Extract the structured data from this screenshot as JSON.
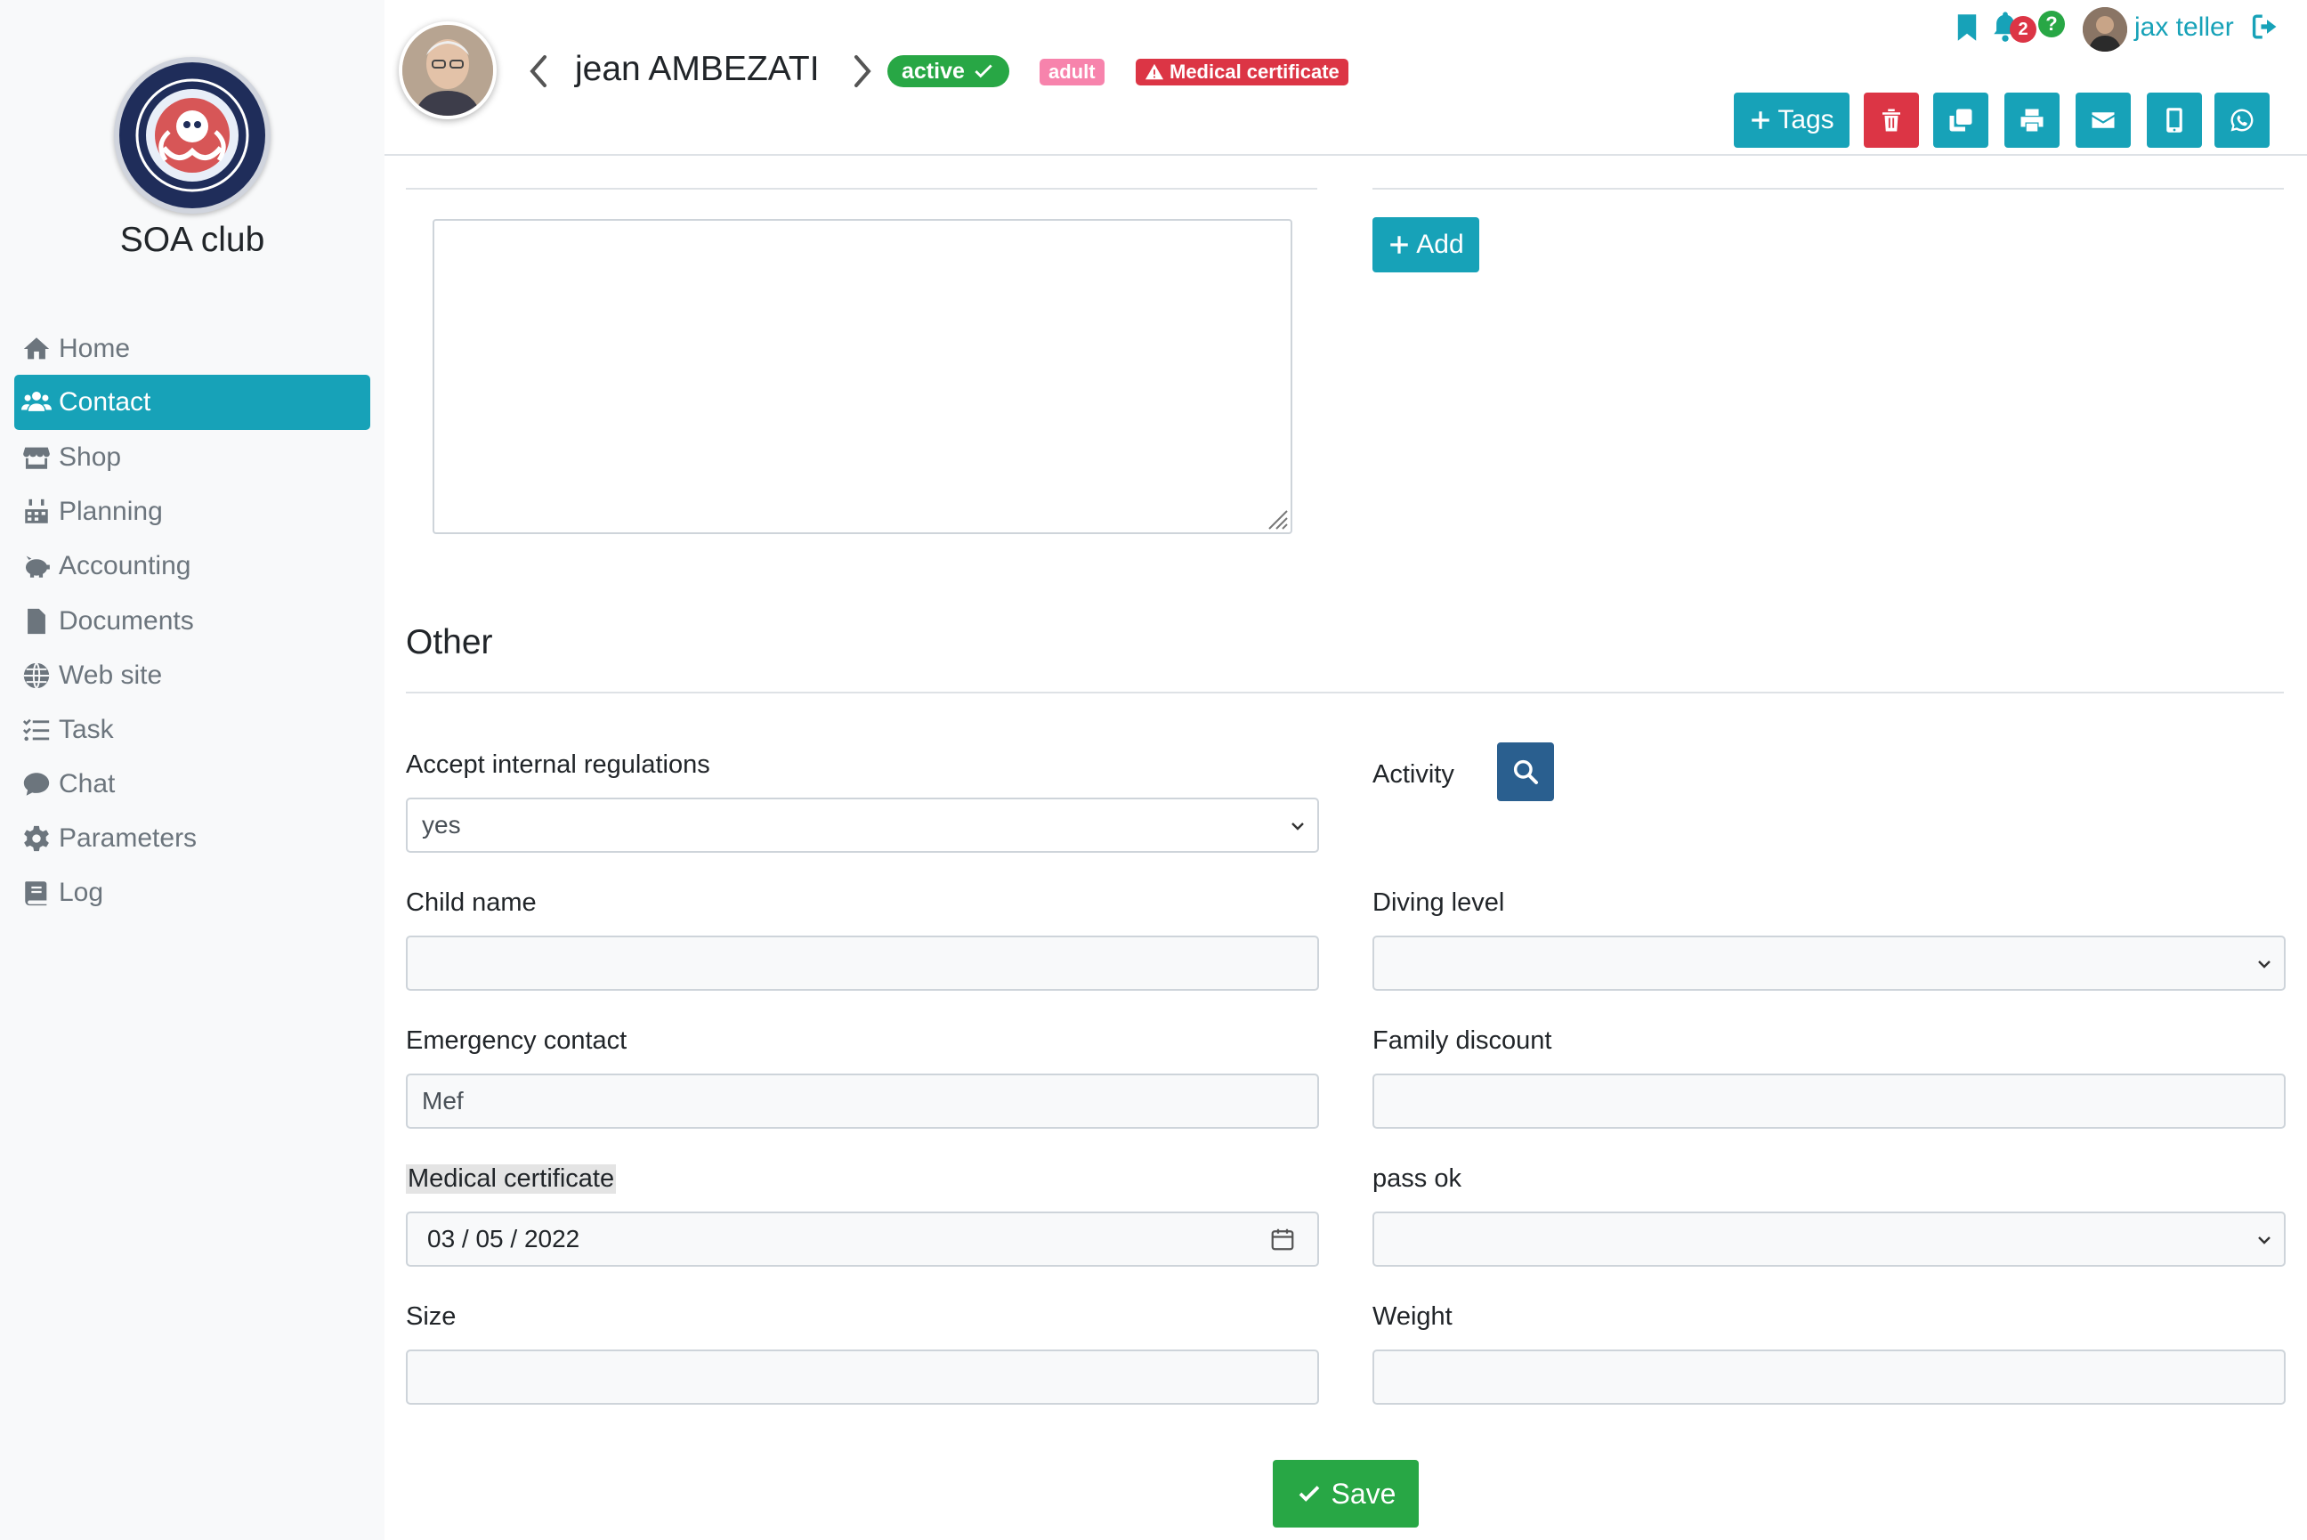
{
  "sidebar": {
    "club_name": "SOA club",
    "items": [
      {
        "label": "Home",
        "icon": "home-icon"
      },
      {
        "label": "Contact",
        "icon": "users-icon"
      },
      {
        "label": "Shop",
        "icon": "store-icon"
      },
      {
        "label": "Planning",
        "icon": "calendar-icon"
      },
      {
        "label": "Accounting",
        "icon": "piggy-bank-icon"
      },
      {
        "label": "Documents",
        "icon": "file-icon"
      },
      {
        "label": "Web site",
        "icon": "globe-icon"
      },
      {
        "label": "Task",
        "icon": "tasks-icon"
      },
      {
        "label": "Chat",
        "icon": "chat-icon"
      },
      {
        "label": "Parameters",
        "icon": "gear-icon"
      },
      {
        "label": "Log",
        "icon": "book-icon"
      }
    ],
    "active_index": 1
  },
  "header": {
    "contact_name": "jean AMBEZATI",
    "badges": {
      "status": "active",
      "category": "adult",
      "warning": "Medical certificate"
    },
    "tags_label": "Tags",
    "user_name": "jax teller",
    "notification_count": "2",
    "help_label": "?"
  },
  "notes": {
    "add_label": "Add"
  },
  "other": {
    "title": "Other",
    "fields": {
      "accept_regulations": {
        "label": "Accept internal regulations",
        "value": "yes"
      },
      "activity": {
        "label": "Activity"
      },
      "child_name": {
        "label": "Child name",
        "value": ""
      },
      "diving_level": {
        "label": "Diving level",
        "value": ""
      },
      "emergency_contact": {
        "label": "Emergency contact",
        "value": "Mef"
      },
      "family_discount": {
        "label": "Family discount",
        "value": ""
      },
      "medical_certificate": {
        "label": "Medical certificate",
        "value": "03 / 05 / 2022"
      },
      "pass_ok": {
        "label": "pass ok",
        "value": ""
      },
      "size": {
        "label": "Size",
        "value": ""
      },
      "weight": {
        "label": "Weight",
        "value": ""
      }
    }
  },
  "save_label": "Save",
  "colors": {
    "primary": "#17a2b8",
    "success": "#28a745",
    "danger": "#dc3545",
    "pink": "#f783ac",
    "dark_blue": "#2a5f8f"
  }
}
